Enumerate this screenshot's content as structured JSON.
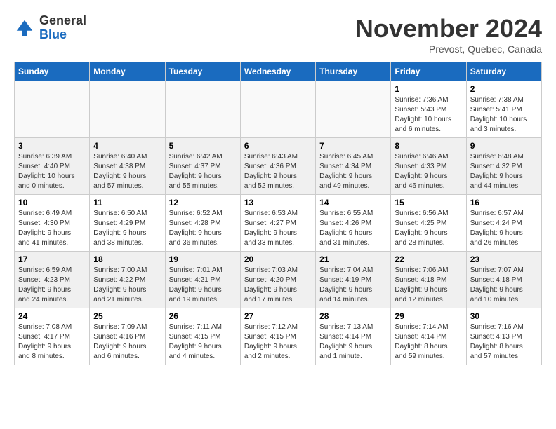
{
  "logo": {
    "general": "General",
    "blue": "Blue"
  },
  "title": "November 2024",
  "subtitle": "Prevost, Quebec, Canada",
  "days_of_week": [
    "Sunday",
    "Monday",
    "Tuesday",
    "Wednesday",
    "Thursday",
    "Friday",
    "Saturday"
  ],
  "weeks": [
    [
      {
        "day": "",
        "info": ""
      },
      {
        "day": "",
        "info": ""
      },
      {
        "day": "",
        "info": ""
      },
      {
        "day": "",
        "info": ""
      },
      {
        "day": "",
        "info": ""
      },
      {
        "day": "1",
        "info": "Sunrise: 7:36 AM\nSunset: 5:43 PM\nDaylight: 10 hours\nand 6 minutes."
      },
      {
        "day": "2",
        "info": "Sunrise: 7:38 AM\nSunset: 5:41 PM\nDaylight: 10 hours\nand 3 minutes."
      }
    ],
    [
      {
        "day": "3",
        "info": "Sunrise: 6:39 AM\nSunset: 4:40 PM\nDaylight: 10 hours\nand 0 minutes."
      },
      {
        "day": "4",
        "info": "Sunrise: 6:40 AM\nSunset: 4:38 PM\nDaylight: 9 hours\nand 57 minutes."
      },
      {
        "day": "5",
        "info": "Sunrise: 6:42 AM\nSunset: 4:37 PM\nDaylight: 9 hours\nand 55 minutes."
      },
      {
        "day": "6",
        "info": "Sunrise: 6:43 AM\nSunset: 4:36 PM\nDaylight: 9 hours\nand 52 minutes."
      },
      {
        "day": "7",
        "info": "Sunrise: 6:45 AM\nSunset: 4:34 PM\nDaylight: 9 hours\nand 49 minutes."
      },
      {
        "day": "8",
        "info": "Sunrise: 6:46 AM\nSunset: 4:33 PM\nDaylight: 9 hours\nand 46 minutes."
      },
      {
        "day": "9",
        "info": "Sunrise: 6:48 AM\nSunset: 4:32 PM\nDaylight: 9 hours\nand 44 minutes."
      }
    ],
    [
      {
        "day": "10",
        "info": "Sunrise: 6:49 AM\nSunset: 4:30 PM\nDaylight: 9 hours\nand 41 minutes."
      },
      {
        "day": "11",
        "info": "Sunrise: 6:50 AM\nSunset: 4:29 PM\nDaylight: 9 hours\nand 38 minutes."
      },
      {
        "day": "12",
        "info": "Sunrise: 6:52 AM\nSunset: 4:28 PM\nDaylight: 9 hours\nand 36 minutes."
      },
      {
        "day": "13",
        "info": "Sunrise: 6:53 AM\nSunset: 4:27 PM\nDaylight: 9 hours\nand 33 minutes."
      },
      {
        "day": "14",
        "info": "Sunrise: 6:55 AM\nSunset: 4:26 PM\nDaylight: 9 hours\nand 31 minutes."
      },
      {
        "day": "15",
        "info": "Sunrise: 6:56 AM\nSunset: 4:25 PM\nDaylight: 9 hours\nand 28 minutes."
      },
      {
        "day": "16",
        "info": "Sunrise: 6:57 AM\nSunset: 4:24 PM\nDaylight: 9 hours\nand 26 minutes."
      }
    ],
    [
      {
        "day": "17",
        "info": "Sunrise: 6:59 AM\nSunset: 4:23 PM\nDaylight: 9 hours\nand 24 minutes."
      },
      {
        "day": "18",
        "info": "Sunrise: 7:00 AM\nSunset: 4:22 PM\nDaylight: 9 hours\nand 21 minutes."
      },
      {
        "day": "19",
        "info": "Sunrise: 7:01 AM\nSunset: 4:21 PM\nDaylight: 9 hours\nand 19 minutes."
      },
      {
        "day": "20",
        "info": "Sunrise: 7:03 AM\nSunset: 4:20 PM\nDaylight: 9 hours\nand 17 minutes."
      },
      {
        "day": "21",
        "info": "Sunrise: 7:04 AM\nSunset: 4:19 PM\nDaylight: 9 hours\nand 14 minutes."
      },
      {
        "day": "22",
        "info": "Sunrise: 7:06 AM\nSunset: 4:18 PM\nDaylight: 9 hours\nand 12 minutes."
      },
      {
        "day": "23",
        "info": "Sunrise: 7:07 AM\nSunset: 4:18 PM\nDaylight: 9 hours\nand 10 minutes."
      }
    ],
    [
      {
        "day": "24",
        "info": "Sunrise: 7:08 AM\nSunset: 4:17 PM\nDaylight: 9 hours\nand 8 minutes."
      },
      {
        "day": "25",
        "info": "Sunrise: 7:09 AM\nSunset: 4:16 PM\nDaylight: 9 hours\nand 6 minutes."
      },
      {
        "day": "26",
        "info": "Sunrise: 7:11 AM\nSunset: 4:15 PM\nDaylight: 9 hours\nand 4 minutes."
      },
      {
        "day": "27",
        "info": "Sunrise: 7:12 AM\nSunset: 4:15 PM\nDaylight: 9 hours\nand 2 minutes."
      },
      {
        "day": "28",
        "info": "Sunrise: 7:13 AM\nSunset: 4:14 PM\nDaylight: 9 hours\nand 1 minute."
      },
      {
        "day": "29",
        "info": "Sunrise: 7:14 AM\nSunset: 4:14 PM\nDaylight: 8 hours\nand 59 minutes."
      },
      {
        "day": "30",
        "info": "Sunrise: 7:16 AM\nSunset: 4:13 PM\nDaylight: 8 hours\nand 57 minutes."
      }
    ]
  ]
}
